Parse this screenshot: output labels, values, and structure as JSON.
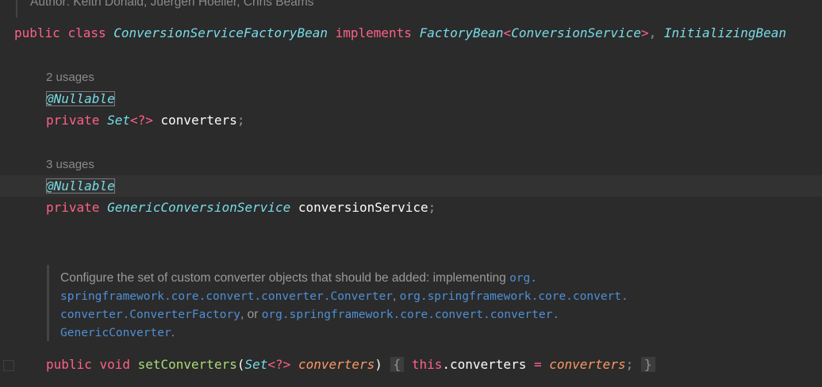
{
  "author_line": "Author: Keith Donald, Juergen Hoeller, Chris Beams",
  "class_decl": {
    "kw_public": "public",
    "kw_class": "class",
    "class_name": "ConversionServiceFactoryBean",
    "kw_implements": "implements",
    "iface1": "FactoryBean",
    "lt": "<",
    "iface1_arg": "ConversionService",
    "gt": ">",
    "comma": ",",
    "iface2": "InitializingBean"
  },
  "field1": {
    "usages": "2 usages",
    "annotation": "@Nullable",
    "kw_private": "private",
    "type": "Set",
    "generic": "<?>",
    "name": "converters",
    "semi": ";"
  },
  "field2": {
    "usages": "3 usages",
    "annotation": "@Nullable",
    "kw_private": "private",
    "type": "GenericConversionService",
    "name": "conversionService",
    "semi": ";"
  },
  "javadoc": {
    "l1_text": "Configure the set of custom converter objects that should be added: implementing ",
    "l1_code": "org.",
    "l2_code": "springframework.core.convert.converter.Converter",
    "l2_text": ", ",
    "l2_code2": "org.springframework.core.convert.",
    "l3_code": "converter.ConverterFactory",
    "l3_text": ", or ",
    "l3_code2": "org.springframework.core.convert.converter.",
    "l4_code": "GenericConverter",
    "l4_text": "."
  },
  "method": {
    "kw_public": "public",
    "kw_void": "void",
    "name": "setConverters",
    "lparen": "(",
    "param_type": "Set",
    "param_generic": "<?>",
    "param_name": "converters",
    "rparen": ")",
    "lbrace": "{",
    "kw_this": "this",
    "dot": ".",
    "field": "converters",
    "eq": "=",
    "rhs": "converters",
    "semi": ";",
    "rbrace": "}"
  }
}
